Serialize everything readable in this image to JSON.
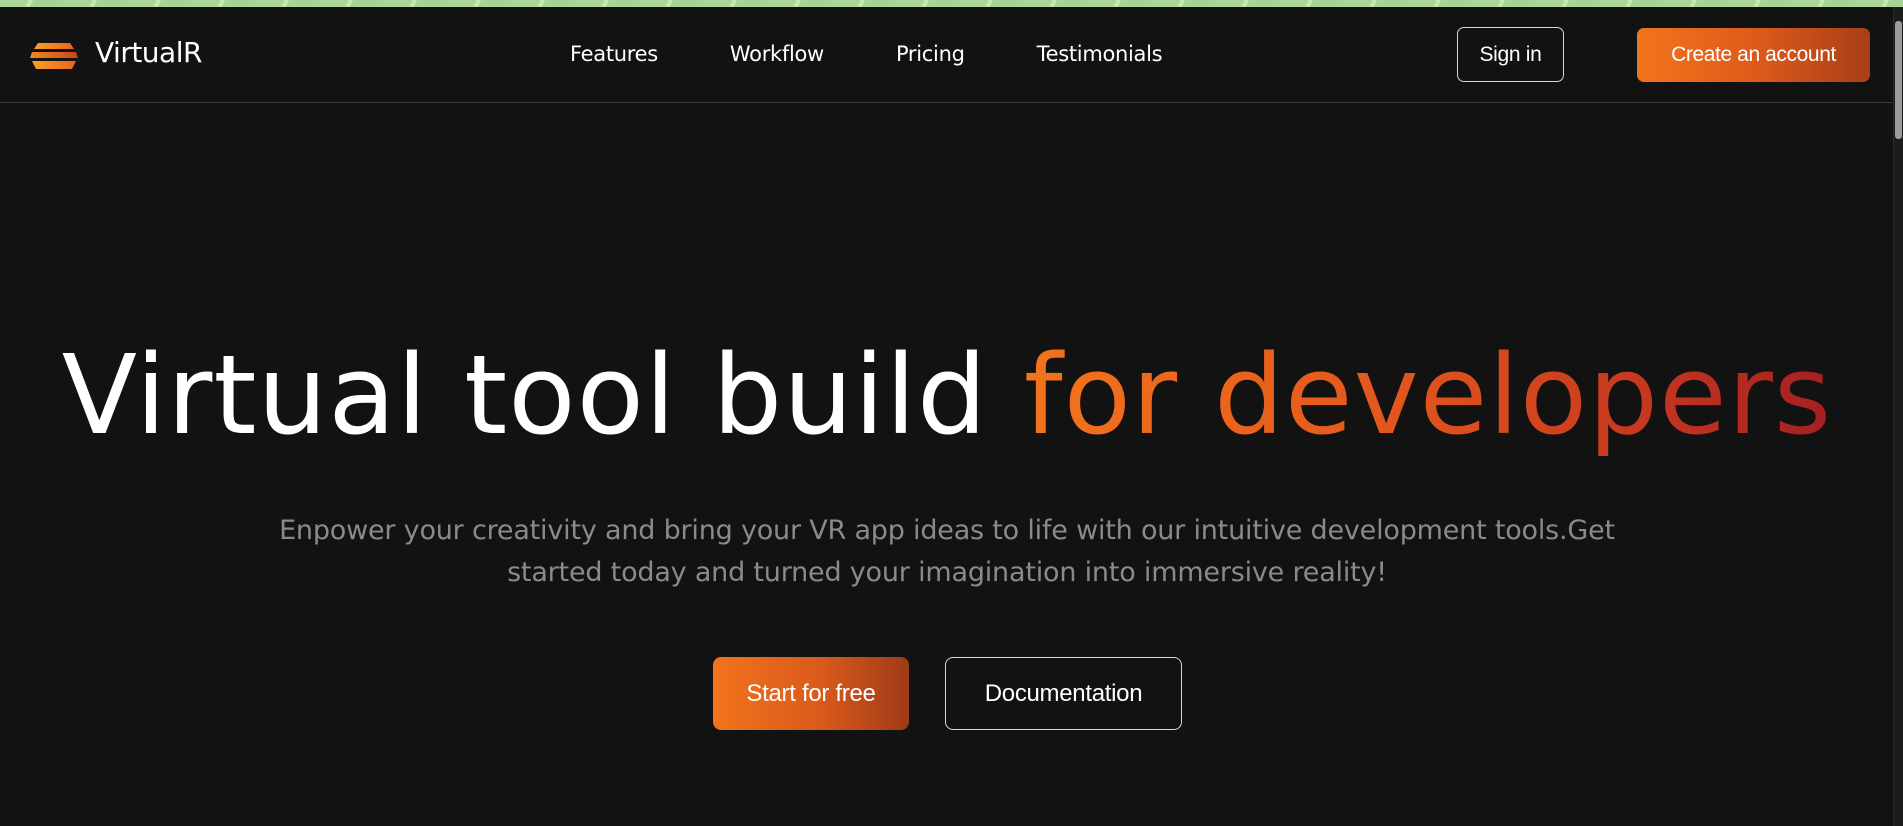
{
  "brand": {
    "name": "VirtualR",
    "logo_icon": "layered-stack-icon",
    "accent_colors": [
      "#f2741c",
      "#a51f22"
    ]
  },
  "nav": {
    "links": [
      {
        "label": "Features"
      },
      {
        "label": "Workflow"
      },
      {
        "label": "Pricing"
      },
      {
        "label": "Testimonials"
      }
    ],
    "sign_in_label": "Sign in",
    "create_account_label": "Create an account"
  },
  "hero": {
    "title_plain": "Virtual tool build ",
    "title_accent": "for developers",
    "subtitle": "Enpower your creativity and bring your VR app ideas to life with our intuitive development tools.Get started today and turned your imagination into immersive reality!",
    "primary_button_label": "Start for free",
    "secondary_button_label": "Documentation"
  },
  "colors": {
    "background": "#121212",
    "text": "#ffffff",
    "muted_text": "#8a8a8a"
  }
}
